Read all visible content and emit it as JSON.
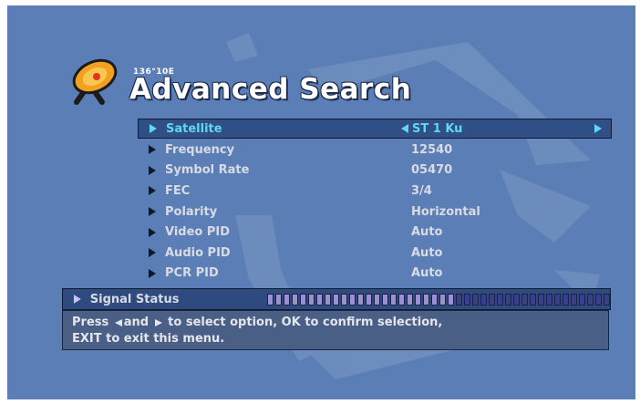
{
  "header": {
    "position_label": "136°10E",
    "title": "Advanced Search"
  },
  "menu": {
    "items": [
      {
        "label": "Satellite",
        "value": "ST 1 Ku",
        "selected": true
      },
      {
        "label": "Frequency",
        "value": "12540"
      },
      {
        "label": "Symbol Rate",
        "value": "05470"
      },
      {
        "label": "FEC",
        "value": "3/4"
      },
      {
        "label": "Polarity",
        "value": "Horizontal"
      },
      {
        "label": "Video PID",
        "value": "Auto"
      },
      {
        "label": "Audio PID",
        "value": "Auto"
      },
      {
        "label": "PCR PID",
        "value": "Auto"
      }
    ]
  },
  "signal": {
    "label": "Signal Status",
    "level": 0.55
  },
  "help": {
    "line1_a": "Press",
    "line1_b": "and",
    "line1_c": "to select option, OK to confirm selection,",
    "line2": "EXIT to exit this menu."
  },
  "colors": {
    "background": "#5b7eb6",
    "selected_text": "#5fd8f0",
    "bar_filled": "#9b8fd6",
    "bar_empty": "#3a3f8c"
  }
}
